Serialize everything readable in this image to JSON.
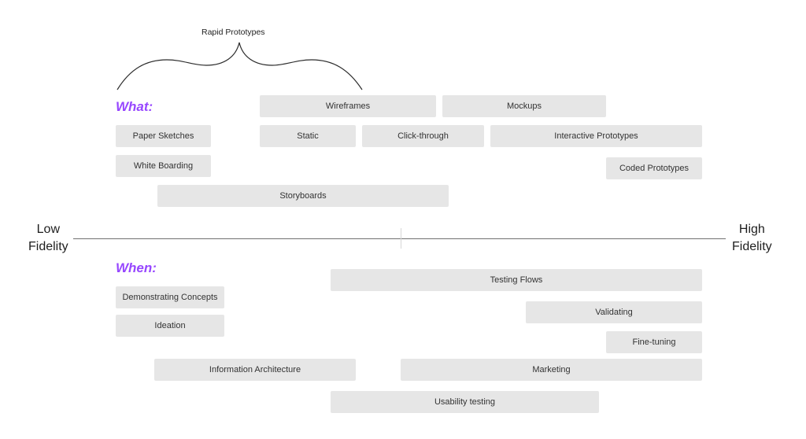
{
  "brace": {
    "label": "Rapid Prototypes"
  },
  "axis": {
    "low_label_line1": "Low",
    "low_label_line2": "Fidelity",
    "high_label_line1": "High",
    "high_label_line2": "Fidelity"
  },
  "what": {
    "label": "What:",
    "items": [
      "Wireframes",
      "Mockups",
      "Paper Sketches",
      "Static",
      "Click-through",
      "Interactive Prototypes",
      "White Boarding",
      "Coded Prototypes",
      "Storyboards"
    ]
  },
  "when": {
    "label": "When:",
    "items": [
      "Testing Flows",
      "Demonstrating Concepts",
      "Validating",
      "Ideation",
      "Fine-tuning",
      "Information Architecture",
      "Marketing",
      "Usability testing"
    ]
  },
  "colors": {
    "accent": "#9747ff",
    "box": "#e6e6e6",
    "axis": "#707070"
  }
}
